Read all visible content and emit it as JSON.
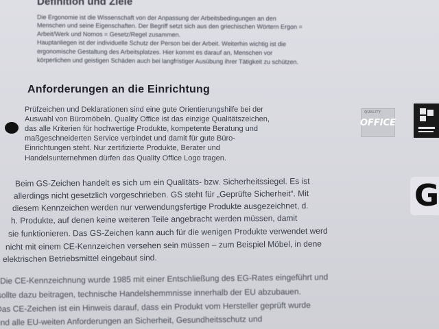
{
  "heading_top": "Definition und Ziele",
  "intro_lines": [
    "Die Ergonomie ist die Wissenschaft von der Anpassung der Arbeitsbedingungen an den",
    "Menschen und seine Eigenschaften. Der Begriff setzt sich aus den griechischen Wörtern Ergon =",
    "Arbeit/Werk und Nomos = Gesetz/Regel zusammen.",
    "Hauptanliegen ist der individuelle Schutz der Person bei der Arbeit. Weiterhin wichtig ist die",
    "ergonomische Gestaltung des Arbeitsplatzes. Hier kommt es darauf an, Menschen vor",
    "körperlichen und geistigen Schäden auch bei langfristiger Ausübung ihrer Tätigkeit zu schützen."
  ],
  "heading_section": "Anforderungen an die Einrichtung",
  "quality_lines": [
    "Prüfzeichen und Deklarationen sind eine gute Orientierungshilfe bei der",
    "Auswahl von Büromöbeln. Quality Office ist das einzige Qualitätszeichen,",
    "das alle Kriterien für hochwertige Produkte, kompetente Beratung und",
    "maßgeschneiderten Service verbindet und damit für gute Büro-",
    "Einrichtungen steht. Nur zertifizierte Produkte, Berater und",
    "Handelsunternehmen dürfen das Quality Office Logo tragen."
  ],
  "gs_lines": [
    "Beim GS-Zeichen handelt es sich um ein Qualitäts- bzw. Sicherheitssiegel. Es ist",
    "allerdings nicht gesetzlich vorgeschrieben. GS steht für „Geprüfte Sicherheit“. Mit",
    "diesem Kennzeichen werden nur verwendungsfertige Produkte ausgezeichnet, d.",
    "h. Produkte, auf denen keine weiteren Teile angebracht werden müssen, damit",
    "sie funktionieren. Das GS-Zeichen kann auch für die wenigen Produkte verwendet werd",
    "nicht mit einem CE-Kennzeichen versehen sein müssen – zum Beispiel Möbel, in dene",
    "elektrischen Betriebsmittel eingebaut sind."
  ],
  "ce_lines": [
    "Die CE-Kennzeichnung wurde 1985 mit einer Entschließung des EG-Rates eingeführt und",
    "sollte dazu beitragen, technische Handelshemmnisse innerhalb der EU abzubauen.",
    "Das CE-Zeichen ist ein Hinweis darauf, dass ein Produkt vom Hersteller geprüft wurde",
    "und alle EU-weiten Anforderungen an Sicherheit, Gesundheitsschutz und"
  ],
  "logos": {
    "quality_office_small": "QUALITY",
    "quality_office_text": "OFFICE",
    "gs_mark": "G"
  }
}
